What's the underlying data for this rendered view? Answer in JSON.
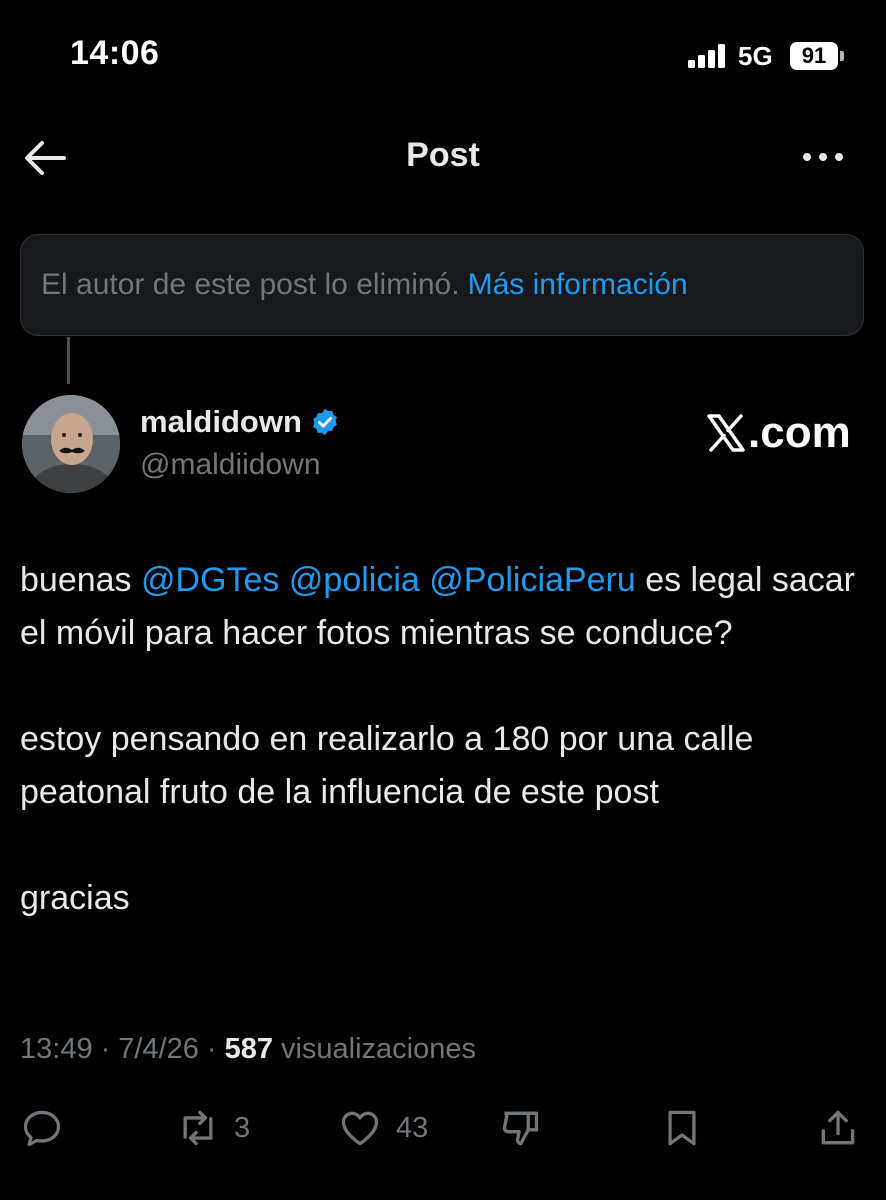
{
  "status_bar": {
    "time": "14:06",
    "network": "5G",
    "battery": "91"
  },
  "header": {
    "title": "Post"
  },
  "notice": {
    "text": "El autor de este post lo eliminó.",
    "link": "Más información"
  },
  "author": {
    "name": "maldidown",
    "handle": "@maldiidown"
  },
  "source_mark": ".com",
  "post": {
    "line1_prefix": "buenas ",
    "mentions": [
      "@DGTes",
      "@policia",
      "@PoliciaPeru"
    ],
    "line1_suffix": " es legal sacar el móvil para hacer fotos mientras se conduce?",
    "paragraph2": "estoy pensando en realizarlo a 180 por una calle peatonal fruto de la influencia de este post",
    "paragraph3": "gracias"
  },
  "meta": {
    "time": "13:49",
    "date": "7/4/26",
    "views_count": "587",
    "views_label": "visualizaciones",
    "separator": "·"
  },
  "actions": {
    "reposts": "3",
    "likes": "43"
  },
  "colors": {
    "accent": "#1d9bf0",
    "muted": "#71767b",
    "background": "#000000",
    "text": "#e7e9ea"
  },
  "icons": [
    "signal-icon",
    "battery-icon",
    "back-arrow-icon",
    "more-icon",
    "verified-badge-icon",
    "x-logo-icon",
    "reply-icon",
    "repost-icon",
    "like-icon",
    "dislike-icon",
    "bookmark-icon",
    "share-icon"
  ]
}
